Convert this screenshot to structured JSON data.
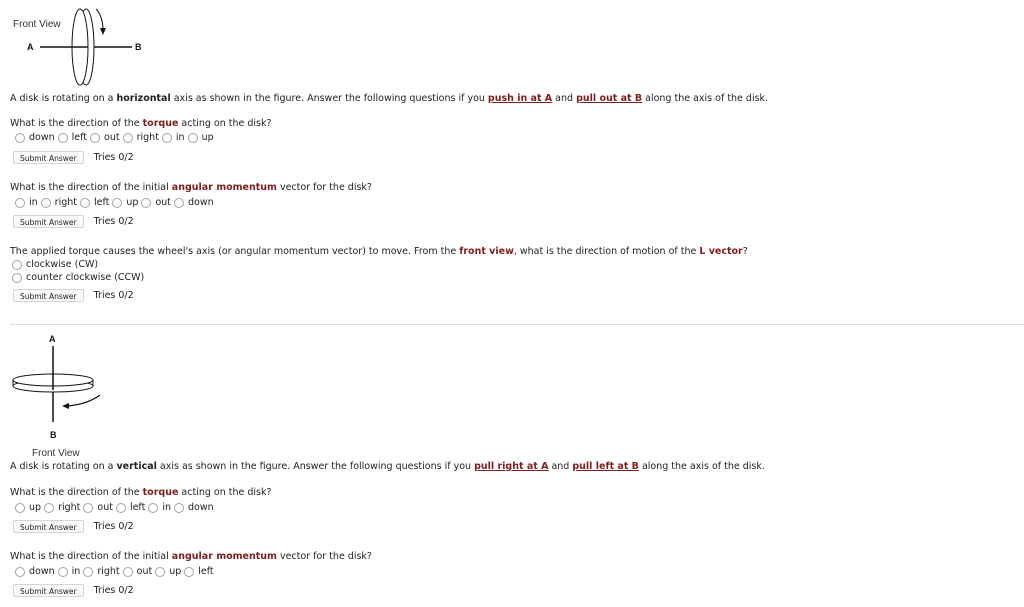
{
  "fig1": {
    "caption": "Front View",
    "label_a": "A",
    "label_b": "B"
  },
  "problem1": {
    "intro": {
      "p1": "A disk is rotating on a ",
      "b1": "horizontal",
      "p2": " axis as shown in the figure. Answer the following questions if you ",
      "l1": "push in at A",
      "p3": " and ",
      "l2": "pull out at B",
      "p4": " along the axis of the disk."
    },
    "questions": [
      {
        "pre": "What is the direction of the ",
        "bold": "torque",
        "post": " acting on the disk?",
        "options": [
          "down",
          "left",
          "out",
          "right",
          "in",
          "up"
        ],
        "submit": "Submit Answer",
        "tries": "Tries 0/2"
      },
      {
        "pre": "What is the direction of the initial ",
        "bold": "angular momentum",
        "post": " vector for the disk?",
        "options": [
          "in",
          "right",
          "left",
          "up",
          "out",
          "down"
        ],
        "submit": "Submit Answer",
        "tries": "Tries 0/2"
      },
      {
        "pre": "The applied torque causes the wheel's axis (or angular momentum vector) to move. From the ",
        "bold": "front view",
        "mid": ", what is the direction of motion of the ",
        "bold2": "L vector",
        "post": "?",
        "options": [
          "clockwise (CW)",
          "counter clockwise (CCW)"
        ],
        "submit": "Submit Answer",
        "tries": "Tries 0/2"
      }
    ]
  },
  "fig2": {
    "caption": "Front View",
    "label_a": "A",
    "label_b": "B"
  },
  "problem2": {
    "intro": {
      "p1": "A disk is rotating on a ",
      "b1": "vertical",
      "p2": " axis as shown in the figure. Answer the following questions if you ",
      "l1": "pull right at A",
      "p3": " and ",
      "l2": "pull left at B",
      "p4": " along the axis of the disk."
    },
    "questions": [
      {
        "pre": "What is the direction of the ",
        "bold": "torque",
        "post": " acting on the disk?",
        "options": [
          "up",
          "right",
          "out",
          "left",
          "in",
          "down"
        ],
        "submit": "Submit Answer",
        "tries": "Tries 0/2"
      },
      {
        "pre": "What is the direction of the initial ",
        "bold": "angular momentum",
        "post": " vector for the disk?",
        "options": [
          "down",
          "in",
          "right",
          "out",
          "up",
          "left"
        ],
        "submit": "Submit Answer",
        "tries": "Tries 0/2"
      }
    ]
  }
}
